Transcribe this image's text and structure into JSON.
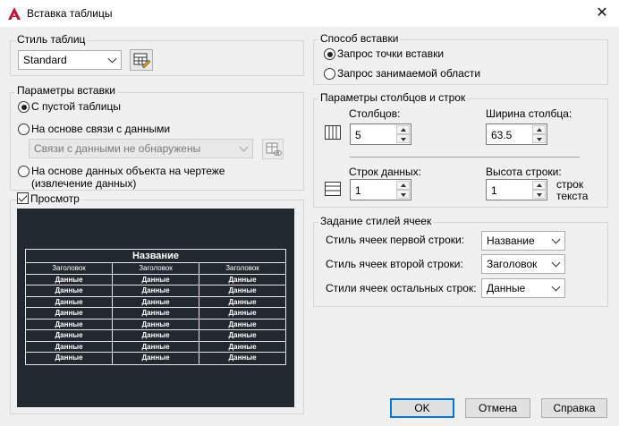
{
  "window": {
    "title": "Вставка таблицы"
  },
  "table_style": {
    "label": "Стиль таблиц",
    "value": "Standard"
  },
  "insert_params": {
    "label": "Параметры вставки",
    "option_empty": "С пустой таблицы",
    "option_link": "На основе связи с данными",
    "link_combo": "Связи с данными не обнаружены",
    "option_object": "На основе данных объекта на чертеже (извлечение данных)"
  },
  "preview": {
    "label": "Просмотр",
    "table_title": "Название",
    "headers": [
      "Заголовок",
      "Заголовок",
      "Заголовок"
    ],
    "rows": [
      [
        "Данные",
        "Данные",
        "Данные"
      ],
      [
        "Данные",
        "Данные",
        "Данные"
      ],
      [
        "Данные",
        "Данные",
        "Данные"
      ],
      [
        "Данные",
        "Данные",
        "Данные"
      ],
      [
        "Данные",
        "Данные",
        "Данные"
      ],
      [
        "Данные",
        "Данные",
        "Данные"
      ],
      [
        "Данные",
        "Данные",
        "Данные"
      ],
      [
        "Данные",
        "Данные",
        "Данные"
      ]
    ]
  },
  "insert_method": {
    "label": "Способ вставки",
    "option_point": "Запрос точки вставки",
    "option_area": "Запрос занимаемой области"
  },
  "columns_rows": {
    "label": "Параметры столбцов и строк",
    "columns_label": "Столбцов:",
    "columns_value": "5",
    "col_width_label": "Ширина столбца:",
    "col_width_value": "63.5",
    "data_rows_label": "Строк данных:",
    "data_rows_value": "1",
    "row_height_label": "Высота строки:",
    "row_height_value": "1",
    "row_height_unit_1": "строк",
    "row_height_unit_2": "текста"
  },
  "cell_styles": {
    "label": "Задание стилей ячеек",
    "first_row_label": "Стиль ячеек первой строки:",
    "first_row_value": "Название",
    "second_row_label": "Стиль ячеек второй строки:",
    "second_row_value": "Заголовок",
    "other_rows_label": "Стили ячеек остальных строк:",
    "other_rows_value": "Данные"
  },
  "buttons": {
    "ok": "OK",
    "cancel": "Отмена",
    "help": "Справка"
  }
}
